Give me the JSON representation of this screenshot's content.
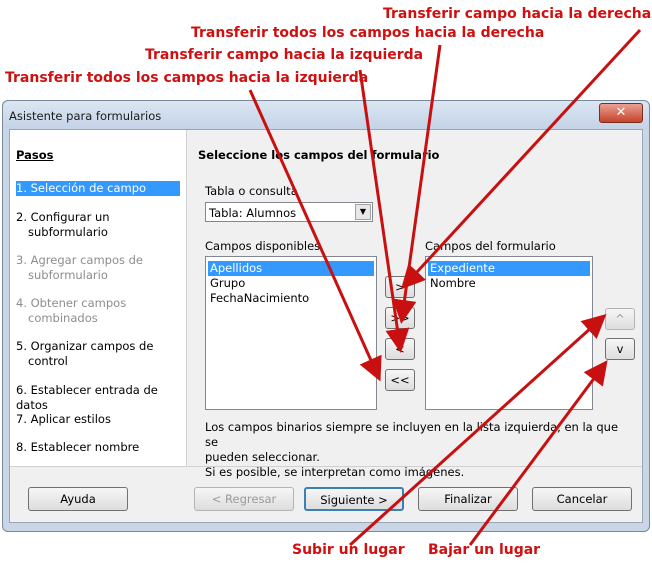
{
  "window": {
    "title": "Asistente para formularios",
    "close_icon": "close-icon"
  },
  "steps": {
    "title": "Pasos",
    "items": [
      {
        "label": "1. Selección de campo",
        "state": "active"
      },
      {
        "label": "2. Configurar un",
        "label2": "subformulario",
        "state": "normal"
      },
      {
        "label": "3. Agregar campos de",
        "label2": "subformulario",
        "state": "disabled"
      },
      {
        "label": "4. Obtener campos",
        "label2": "combinados",
        "state": "disabled"
      },
      {
        "label": "5. Organizar campos de",
        "label2": "control",
        "state": "normal"
      },
      {
        "label": "6. Establecer entrada de datos",
        "state": "normal"
      },
      {
        "label": "7. Aplicar estilos",
        "state": "normal"
      },
      {
        "label": "8. Establecer nombre",
        "state": "normal"
      }
    ]
  },
  "main": {
    "title": "Seleccione los campos del formulario",
    "table_label": "Tabla o consulta",
    "table_value": "Tabla: Alumnos",
    "available_label": "Campos disponibles",
    "available": [
      "Apellidos",
      "Grupo",
      "FechaNacimiento"
    ],
    "form_label": "Campos del formulario",
    "form_fields": [
      "Expediente",
      "Nombre"
    ],
    "move_right": ">",
    "move_all_right": ">>",
    "move_left": "<",
    "move_all_left": "<<",
    "move_up": "^",
    "move_down": "v",
    "info_line1": "Los campos binarios siempre se incluyen en la lista izquierda, en la que se",
    "info_line2": "pueden seleccionar.",
    "info_line3": "Si es posible, se interpretan como imágenes."
  },
  "buttons": {
    "help": "Ayuda",
    "back": "< Regresar",
    "next": "Siguiente >",
    "finish": "Finalizar",
    "cancel": "Cancelar"
  },
  "annotations": {
    "right_one": "Transferir campo hacia la derecha",
    "right_all": "Transferir todos los campos hacia la derecha",
    "left_one": "Transferir campo hacia la izquierda",
    "left_all": "Transferir todos los campos hacia la izquierda",
    "up": "Subir un lugar",
    "down": "Bajar un lugar",
    "color": "#c81010"
  }
}
